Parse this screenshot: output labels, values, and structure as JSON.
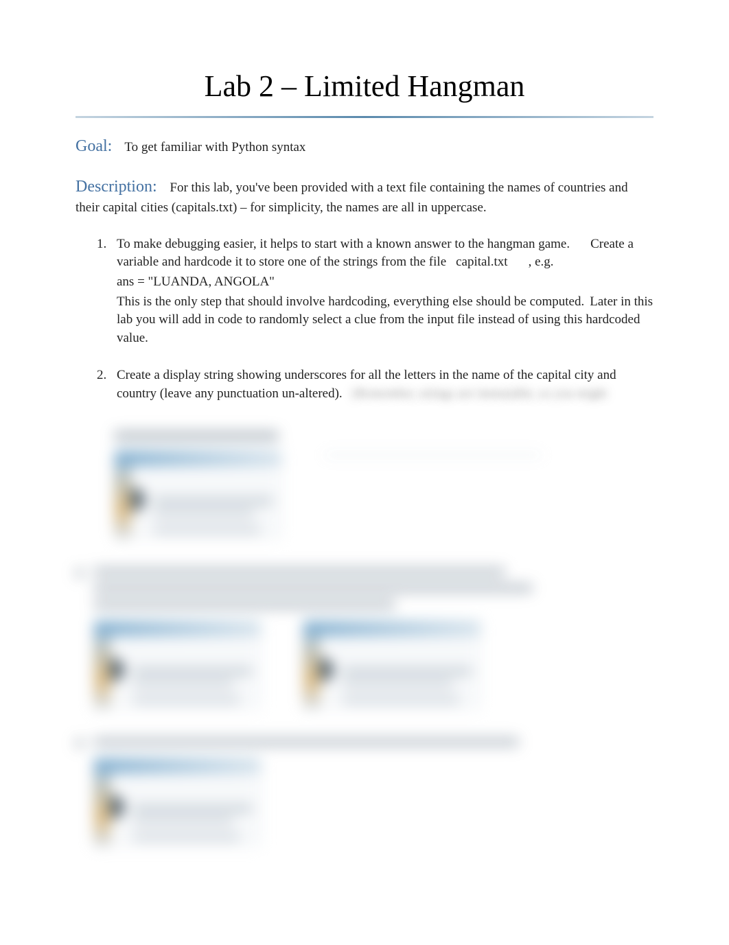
{
  "title": "Lab 2 – Limited Hangman",
  "goal": {
    "label": "Goal:",
    "text": "To get familiar with Python syntax"
  },
  "description": {
    "label": "Description:",
    "text": "For this lab, you've been provided with a text file containing the names of countries and their capital cities (capitals.txt) – for simplicity, the names are all in uppercase."
  },
  "items": [
    {
      "line1_a": "To make debugging easier, it helps to start with a known answer to the hangman game.",
      "line1_b": "Create a variable and hardcode it to store one of the strings from the file",
      "filename": "capital.txt",
      "eg": ", e.g.",
      "code": "ans = \"LUANDA, ANGOLA\"",
      "line2_a": "This is the only step that should involve hardcoding, everything else should be computed.",
      "line2_b": "Later in this lab you will add in code to randomly select a clue from the input file instead of using this hardcoded value."
    },
    {
      "line1": "Create a display string showing underscores for all the letters in the name of the capital city and country (leave any punctuation un-altered).",
      "hint": "(Remember, strings are immutable, so you might"
    }
  ]
}
